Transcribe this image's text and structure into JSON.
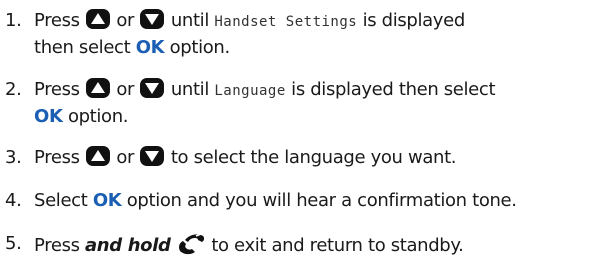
{
  "steps": [
    {
      "number": "1.",
      "line1_a": "Press",
      "or": "or",
      "line1_b": "until",
      "display_text": "Handset Settings",
      "line1_c": "is displayed",
      "line2_a": "then select",
      "ok": "OK",
      "line2_b": "option."
    },
    {
      "number": "2.",
      "line1_a": "Press",
      "or": "or",
      "line1_b": "until",
      "display_text": "Language",
      "line1_c": "is displayed then select",
      "ok": "OK",
      "line2_b": "option."
    },
    {
      "number": "3.",
      "line1_a": "Press",
      "or": "or",
      "line1_b": "to select the language you want."
    },
    {
      "number": "4.",
      "line1_a": "Select",
      "ok": "OK",
      "line1_b": "option and you will hear a confirmation tone."
    },
    {
      "number": "5.",
      "line1_a": "Press",
      "emphasis": "and hold",
      "line1_b": "to exit and return to standby."
    }
  ],
  "icons": {
    "up": "up-arrow-key-icon",
    "down": "down-arrow-key-icon",
    "end_call": "end-call-phone-icon"
  },
  "colors": {
    "ok": "#1a5fb4",
    "text": "#1a1a1a"
  }
}
